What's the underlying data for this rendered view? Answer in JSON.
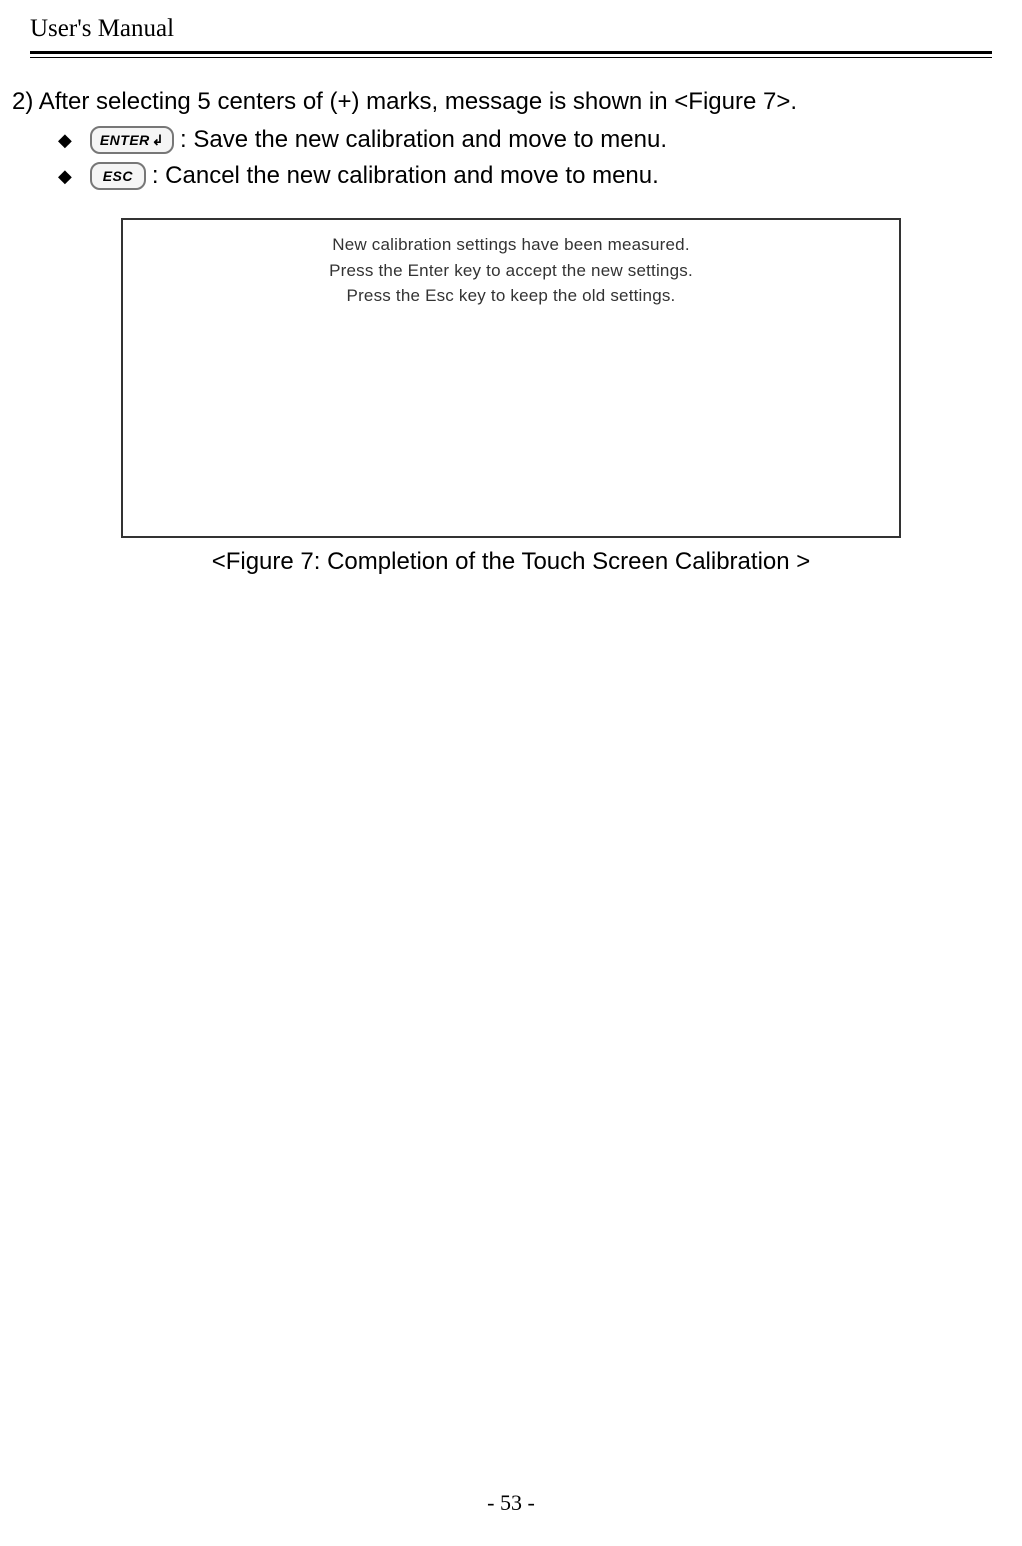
{
  "header": {
    "title": "User's Manual"
  },
  "step": {
    "number": "2)",
    "text": "After selecting 5 centers of (+) marks, message is shown in <Figure 7>."
  },
  "bullets": [
    {
      "key_label": "ENTER",
      "key_symbol": "↲",
      "description": " : Save the new calibration and move to menu."
    },
    {
      "key_label": "ESC",
      "key_symbol": "",
      "description": ": Cancel the new calibration and move to menu."
    }
  ],
  "figure": {
    "lines": [
      "New calibration settings have been measured.",
      "Press the Enter key to accept the new settings.",
      "Press the Esc key to keep the old settings."
    ],
    "caption": "<Figure 7: Completion of the Touch Screen Calibration >"
  },
  "page_number": "- 53 -"
}
